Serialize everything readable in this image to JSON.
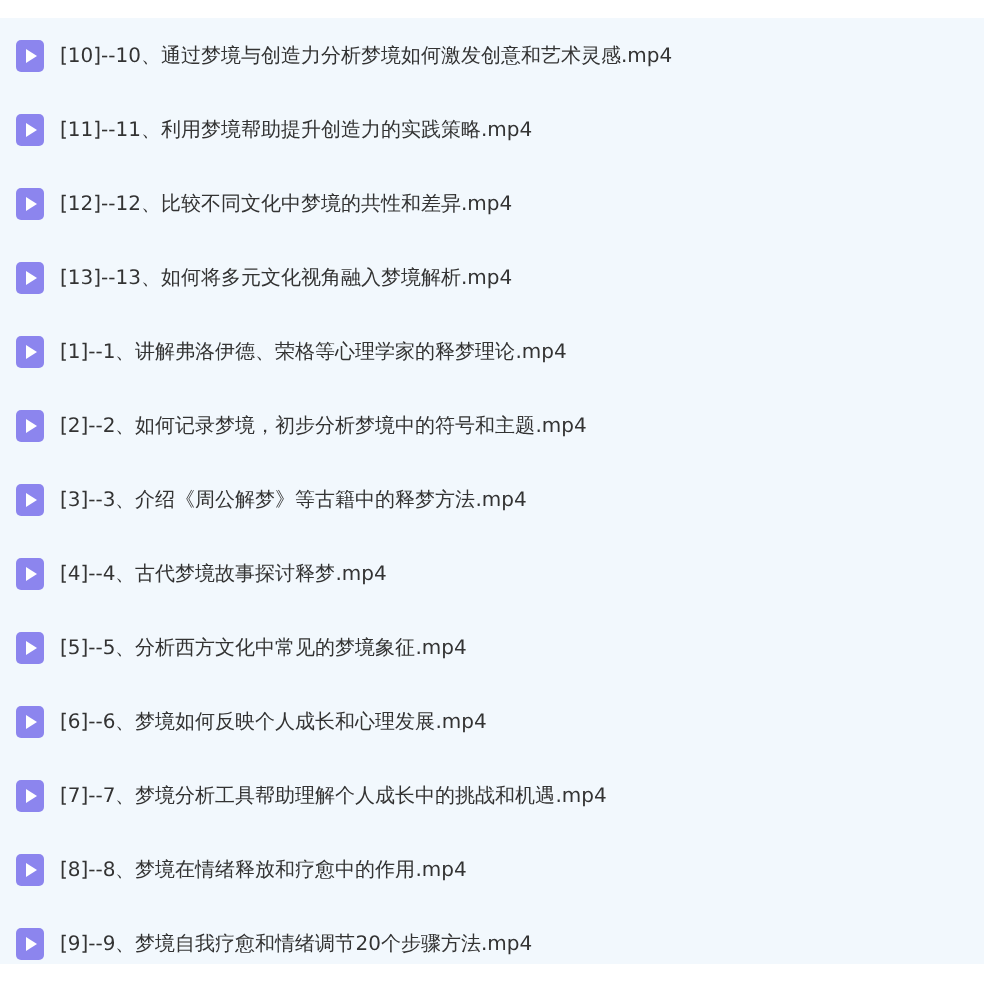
{
  "files": [
    {
      "name": "[10]--10、通过梦境与创造力分析梦境如何激发创意和艺术灵感.mp4"
    },
    {
      "name": "[11]--11、利用梦境帮助提升创造力的实践策略.mp4"
    },
    {
      "name": "[12]--12、比较不同文化中梦境的共性和差异.mp4"
    },
    {
      "name": "[13]--13、如何将多元文化视角融入梦境解析.mp4"
    },
    {
      "name": "[1]--1、讲解弗洛伊德、荣格等心理学家的释梦理论.mp4"
    },
    {
      "name": "[2]--2、如何记录梦境，初步分析梦境中的符号和主题.mp4"
    },
    {
      "name": "[3]--3、介绍《周公解梦》等古籍中的释梦方法.mp4"
    },
    {
      "name": "[4]--4、古代梦境故事探讨释梦.mp4"
    },
    {
      "name": "[5]--5、分析西方文化中常见的梦境象征.mp4"
    },
    {
      "name": "[6]--6、梦境如何反映个人成长和心理发展.mp4"
    },
    {
      "name": "[7]--7、梦境分析工具帮助理解个人成长中的挑战和机遇.mp4"
    },
    {
      "name": "[8]--8、梦境在情绪释放和疗愈中的作用.mp4"
    },
    {
      "name": "[9]--9、梦境自我疗愈和情绪调节20个步骤方法.mp4"
    }
  ]
}
